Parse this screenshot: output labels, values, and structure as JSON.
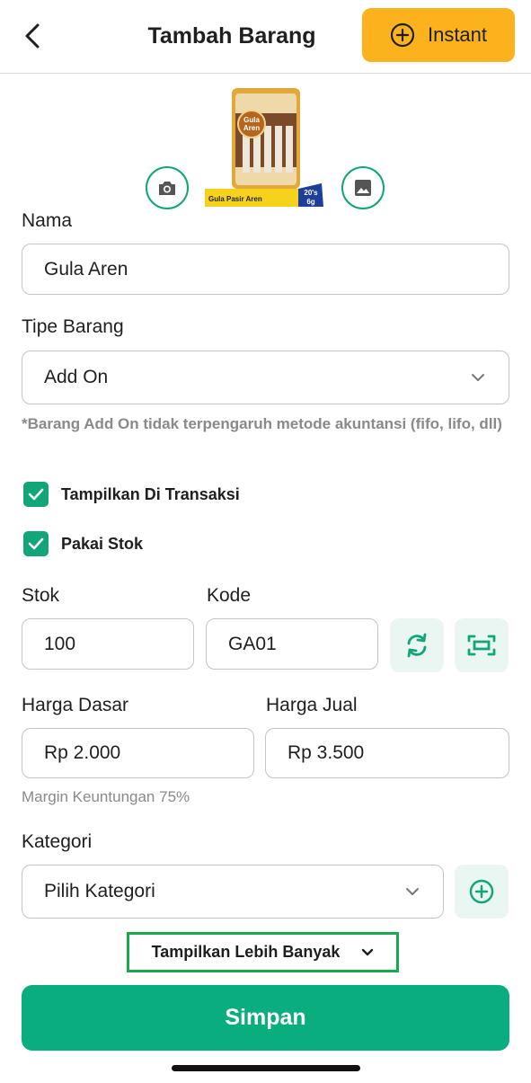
{
  "header": {
    "title": "Tambah Barang",
    "instant_label": "Instant"
  },
  "product_image": {
    "brand_line1": "Gula",
    "brand_line2": "Aren",
    "caption": "Gula Pasir Aren",
    "badge_line1": "20's",
    "badge_line2": "6g"
  },
  "form": {
    "nama": {
      "label": "Nama",
      "value": "Gula Aren"
    },
    "tipe": {
      "label": "Tipe Barang",
      "value": "Add On"
    },
    "note": "*Barang Add On tidak terpengaruh metode akuntansi (fifo, lifo, dll)",
    "checkboxes": [
      {
        "label": "Tampilkan Di Transaksi",
        "checked": true
      },
      {
        "label": "Pakai Stok",
        "checked": true
      }
    ],
    "stok": {
      "label": "Stok",
      "value": "100"
    },
    "kode": {
      "label": "Kode",
      "value": "GA01"
    },
    "harga_dasar": {
      "label": "Harga Dasar",
      "value": "Rp 2.000"
    },
    "harga_jual": {
      "label": "Harga Jual",
      "value": "Rp 3.500"
    },
    "margin": "Margin Keuntungan 75%",
    "kategori": {
      "label": "Kategori",
      "value": "Pilih Kategori"
    }
  },
  "more_label": "Tampilkan Lebih Banyak",
  "save_label": "Simpan",
  "colors": {
    "primary_green": "#0aad7d",
    "accent_yellow": "#fbb21d",
    "icon_bg": "#eaf6f1",
    "highlight_border": "#1aa84c"
  }
}
